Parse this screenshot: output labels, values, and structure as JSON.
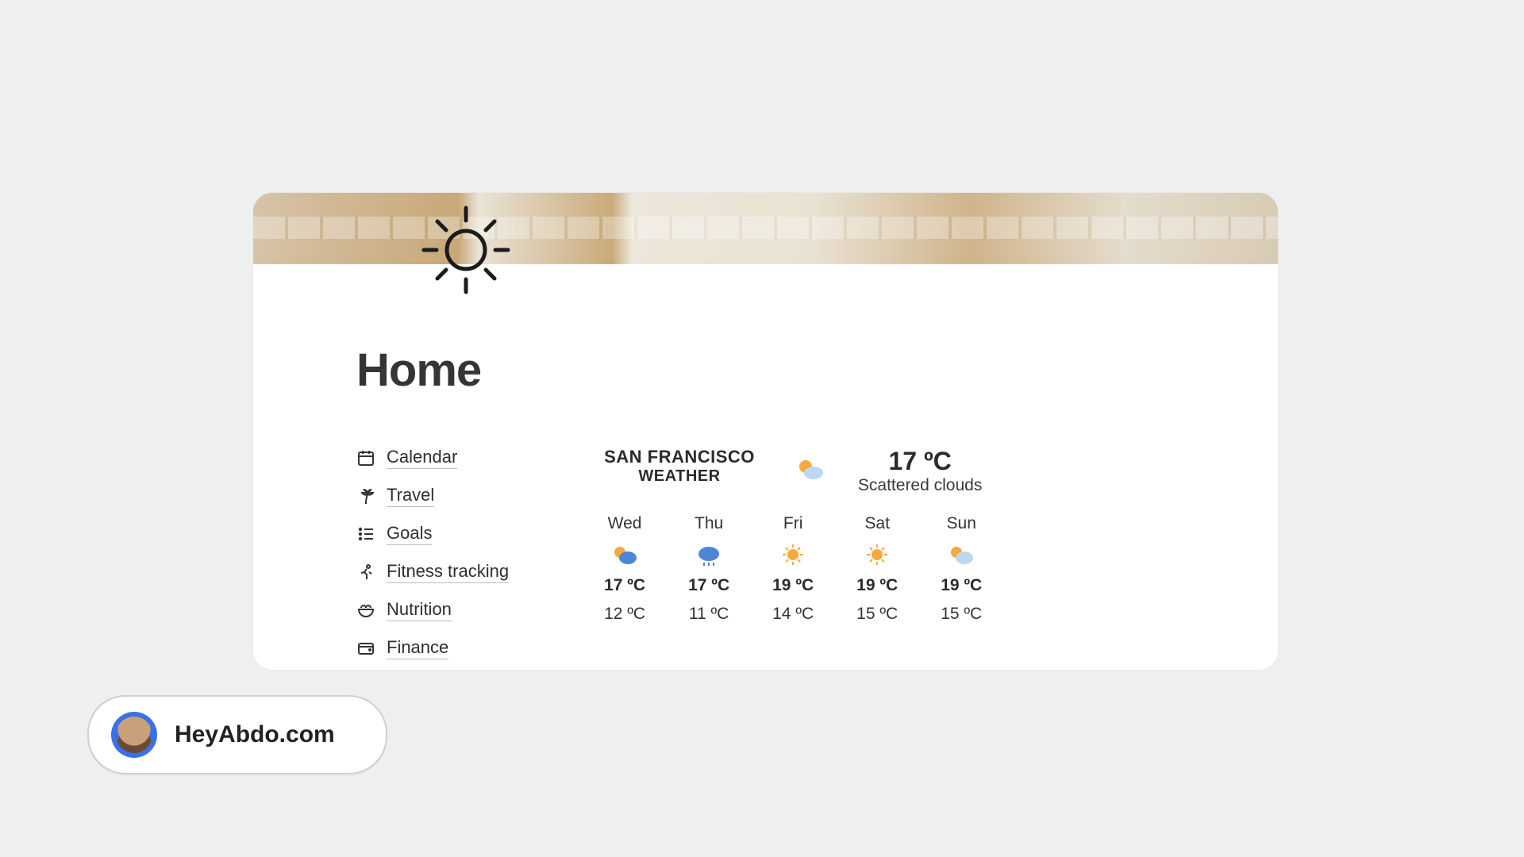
{
  "page": {
    "title": "Home"
  },
  "nav": {
    "items": [
      {
        "icon": "calendar-icon",
        "label": "Calendar"
      },
      {
        "icon": "palm-icon",
        "label": "Travel"
      },
      {
        "icon": "list-icon",
        "label": "Goals"
      },
      {
        "icon": "fitness-icon",
        "label": "Fitness tracking"
      },
      {
        "icon": "bowl-icon",
        "label": "Nutrition"
      },
      {
        "icon": "wallet-icon",
        "label": "Finance"
      }
    ]
  },
  "weather": {
    "location_line1": "SAN FRANCISCO",
    "location_line2": "WEATHER",
    "now": {
      "icon": "partly-cloudy-icon",
      "temp": "17 ºC",
      "desc": "Scattered clouds"
    },
    "forecast": [
      {
        "day": "Wed",
        "icon": "partly-cloudy-icon",
        "hi": "17 ºC",
        "lo": "12 ºC"
      },
      {
        "day": "Thu",
        "icon": "rain-cloud-icon",
        "hi": "17 ºC",
        "lo": "11 ºC"
      },
      {
        "day": "Fri",
        "icon": "sunny-icon",
        "hi": "19 ºC",
        "lo": "14 ºC"
      },
      {
        "day": "Sat",
        "icon": "sunny-icon",
        "hi": "19 ºC",
        "lo": "15 ºC"
      },
      {
        "day": "Sun",
        "icon": "partly-cloudy-icon",
        "hi": "19 ºC",
        "lo": "15 ºC"
      }
    ]
  },
  "attribution": {
    "name": "HeyAbdo.com"
  }
}
